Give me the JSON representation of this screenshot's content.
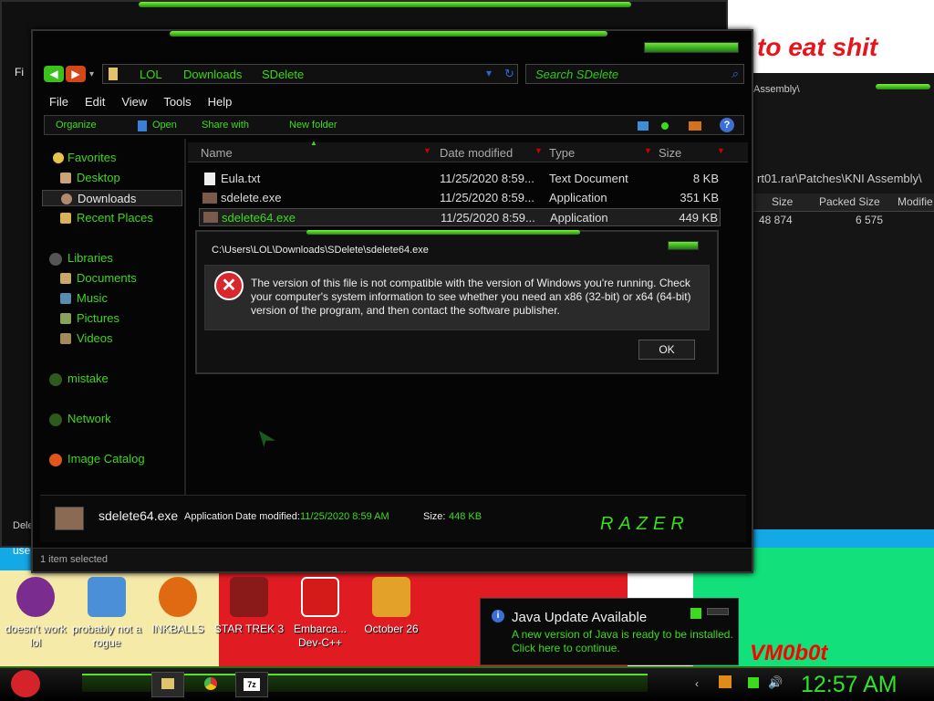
{
  "wallpaper": {
    "headline": "to eat shit",
    "corner_text": "VM0b0t"
  },
  "back_window": {
    "menu_fragment": "Fi",
    "path_fragment": "Assembly\\",
    "archive_path": "rt01.rar\\Patches\\KNI Assembly\\",
    "columns": [
      "Size",
      "Packed Size",
      "Modifie"
    ],
    "values": {
      "size": "48 874",
      "packed": "6 575"
    },
    "bottom_text": "Dele",
    "under_text": "use"
  },
  "explorer": {
    "address": {
      "segments": [
        "LOL",
        "Downloads",
        "SDelete"
      ]
    },
    "search_placeholder": "Search SDelete",
    "menu": [
      "File",
      "Edit",
      "View",
      "Tools",
      "Help"
    ],
    "commands": [
      "Organize",
      "Open",
      "Share with",
      "New folder"
    ],
    "nav": {
      "favorites": "Favorites",
      "desktop": "Desktop",
      "downloads": "Downloads",
      "recent": "Recent Places",
      "libraries": "Libraries",
      "documents": "Documents",
      "music": "Music",
      "pictures": "Pictures",
      "videos": "Videos",
      "mistake": "mistake",
      "network": "Network",
      "catalog": "Image Catalog"
    },
    "columns": {
      "name": "Name",
      "date": "Date modified",
      "type": "Type",
      "size": "Size"
    },
    "files": [
      {
        "name": "Eula.txt",
        "date": "11/25/2020 8:59...",
        "type": "Text Document",
        "size": "8 KB"
      },
      {
        "name": "sdelete.exe",
        "date": "11/25/2020 8:59...",
        "type": "Application",
        "size": "351 KB"
      },
      {
        "name": "sdelete64.exe",
        "date": "11/25/2020 8:59...",
        "type": "Application",
        "size": "449 KB"
      }
    ],
    "details": {
      "filename": "sdelete64.exe",
      "kind": "Application",
      "date_label": "Date modified:",
      "date": "11/25/2020 8:59 AM",
      "size_label": "Size:",
      "size": "448 KB",
      "brand": "RAZER"
    },
    "status": "1 item selected"
  },
  "dialog": {
    "title": "C:\\Users\\LOL\\Downloads\\SDelete\\sdelete64.exe",
    "message": "The version of this file is not compatible with the version of Windows you're running. Check your computer's system information to see whether you need an x86 (32-bit) or x64 (64-bit) version of the program, and then contact the software publisher.",
    "ok": "OK"
  },
  "desktop_icons": [
    {
      "label": "doesn't work lol",
      "icon": "yahoo-messenger-icon",
      "color": "#7b2d8f"
    },
    {
      "label": "probably not a rogue",
      "icon": "gears-icon",
      "color": "#4a8fd8"
    },
    {
      "label": "INKBALLS",
      "icon": "inkball-icon",
      "color": "#e06a12"
    },
    {
      "label": "STAR TREK 3",
      "icon": "star-trek-icon",
      "color": "#8a1a1a"
    },
    {
      "label": "Embarca... Dev-C++",
      "icon": "devcpp-icon",
      "color": "#d51a1a"
    },
    {
      "label": "October 26",
      "icon": "folder-icon",
      "color": "#e3a12a"
    }
  ],
  "notification": {
    "title": "Java Update Available",
    "body": "A new version of Java is ready to be installed. Click here to continue."
  },
  "taskbar": {
    "clock": "12:57 AM"
  },
  "colors": {
    "accent": "#39d80f",
    "bg": "#050505",
    "error": "#d9272e"
  }
}
